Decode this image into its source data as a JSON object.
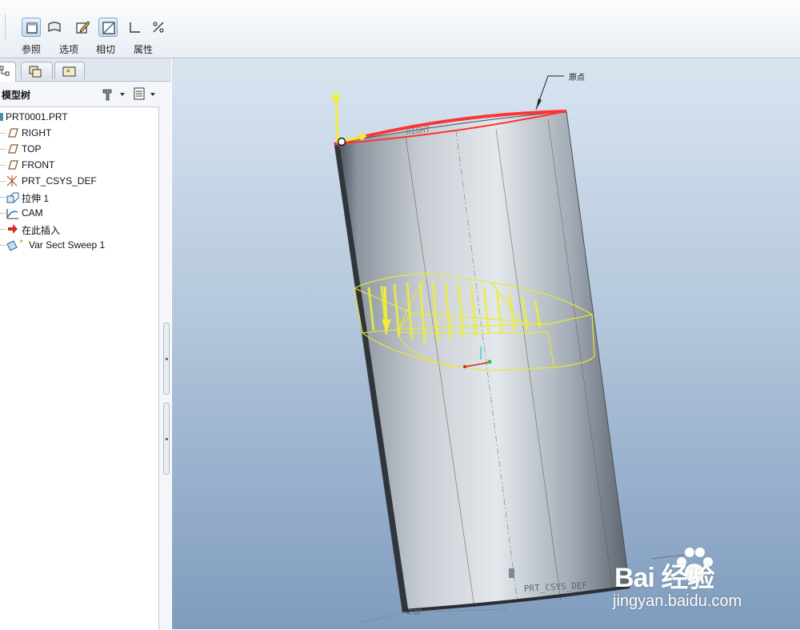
{
  "ribbon": {
    "labels": {
      "references": "参照",
      "options": "选项",
      "tangency": "相切",
      "properties": "属性"
    }
  },
  "panel": {
    "tree_title": "模型树",
    "tree_items": [
      {
        "label": "PRT0001.PRT",
        "icon": "part-icon"
      },
      {
        "label": "RIGHT",
        "icon": "datum-plane-icon"
      },
      {
        "label": "TOP",
        "icon": "datum-plane-icon"
      },
      {
        "label": "FRONT",
        "icon": "datum-plane-icon"
      },
      {
        "label": "PRT_CSYS_DEF",
        "icon": "csys-icon"
      },
      {
        "label": "拉伸 1",
        "icon": "extrude-icon"
      },
      {
        "label": "CAM",
        "icon": "datum-curve-icon"
      },
      {
        "label": "在此插入",
        "icon": "insert-here-arrow-icon"
      },
      {
        "label": "Var Sect Sweep 1",
        "icon": "var-sect-sweep-icon"
      }
    ]
  },
  "viewport": {
    "start_point_label": "原点",
    "plane_label_right": "RIGHT",
    "csys_label": "PRT_CSYS_DEF",
    "plane_label_top": "TOP"
  },
  "watermark": {
    "brand": "Bai 经验",
    "site": "jingyan.baidu.com"
  },
  "colors": {
    "accent_selection": "#ff3333",
    "preview": "#e8e830",
    "model_gray": "#a9b1ba"
  }
}
